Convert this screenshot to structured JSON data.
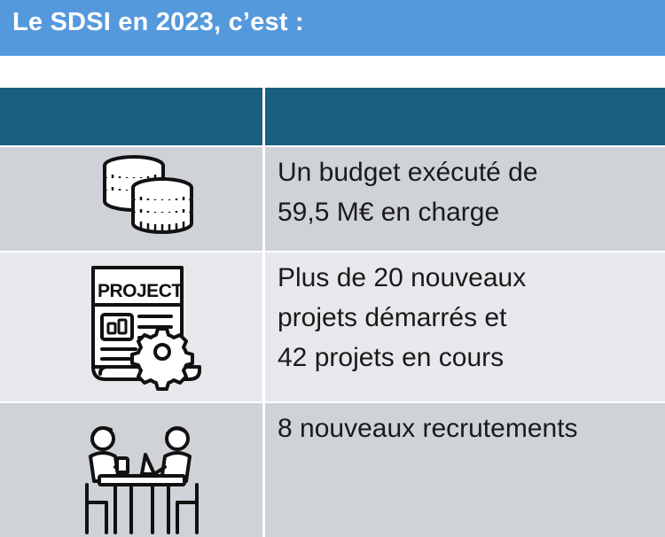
{
  "header": {
    "title": "Le SDSI en 2023, c’est :"
  },
  "table": {
    "header_row": {
      "col1": "",
      "col2": ""
    },
    "rows": [
      {
        "icon": "coins-icon",
        "lines": [
          "Un budget exécuté de",
          "59,5 M€ en charge"
        ]
      },
      {
        "icon": "project-document-gear-icon",
        "icon_label": "PROJECT",
        "lines": [
          "Plus de 20 nouveaux",
          "projets démarrés et",
          "42 projets en cours"
        ]
      },
      {
        "icon": "recruitment-meeting-icon",
        "lines": [
          "8 nouveaux recrutements"
        ]
      }
    ]
  },
  "colors": {
    "banner": "#5599dd",
    "table_header": "#1b5f80",
    "row_dark": "#cfd3d8",
    "row_light": "#e6e8eb"
  }
}
